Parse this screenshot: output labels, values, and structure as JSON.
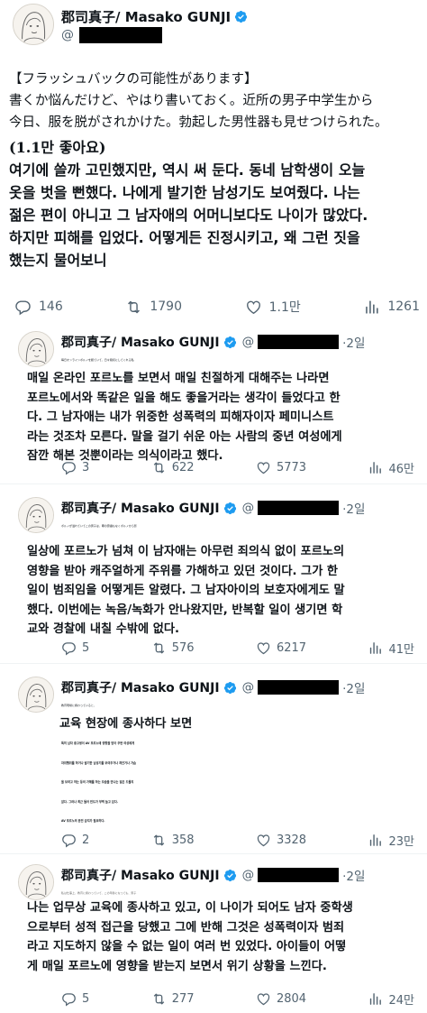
{
  "main": {
    "name": "郡司真子/ Masako GUNJI",
    "handle": "@",
    "jp_lines": [
      "【フラッシュバックの可能性があります】",
      "書くか悩んだけど、やはり書いておく。近所の男子中学生から",
      "今日、服を脱がされかけた。勃起した男性器も見せつけられた。"
    ],
    "likes_note": "(1.1만 좋아요)",
    "kr_lines": [
      "여기에 쓸까 고민했지만, 역시 써 둔다. 동네 남학생이 오늘",
      "옷을 벗을 뻔했다. 나에게 발기한 남성기도 보여줬다. 나는",
      "젊은 편이 아니고 그 남자애의 어머니보다도 나이가 많았다.",
      "하지만 피해를 입었다. 어떻게든 진정시키고, 왜 그런 짓을",
      "했는지 물어보니"
    ],
    "actions": {
      "replies": "146",
      "retweets": "1790",
      "likes": "1.1만",
      "views": "1261"
    }
  },
  "replies": [
    {
      "name": "郡司真子/ Masako GUNJI",
      "handle": "@",
      "date": "·2일",
      "jp_lines": [
        "毎日オンラインポルノを観ていて、日々親切にしてくれる私"
      ],
      "kr_lines": [
        "매일 온라인 포르노를 보면서 매일 친절하게 대해주는 나라면",
        "포르노에서와 똑같은 일을 해도 좋을거라는 생각이 들었다고 한",
        "다. 그 남자애는 내가 위중한 성폭력의 피해자이자 페미니스트",
        "라는 것조차 모른다. 말을 걸기 쉬운 아는 사람의 중년 여성에게",
        "잠깐 해본 것뿐이라는 의식이라고 했다."
      ],
      "actions": {
        "replies": "3",
        "retweets": "622",
        "likes": "5773",
        "views": "46만"
      }
    },
    {
      "name": "郡司真子/ Masako GUNJI",
      "handle": "@",
      "date": "·2일",
      "jp_lines": [
        "ポルノが溢れていてこの男子は、罪の意識もなくポルノから影"
      ],
      "kr_lines": [
        "일상에 포르노가 넘쳐 이 남자애는 아무런 죄의식 없이 포르노의",
        "영향을 받아 캐주얼하게 주위를 가해하고 있던 것이다. 그가 한",
        "일이 범죄임을 어떻게든 알렸다. 그 남자아이의 보호자에게도 말",
        "했다. 이번에는 녹음/녹화가 안나왔지만, 반복할 일이 생기면 학",
        "교와 경찰에 내칠 수밖에 없다."
      ],
      "actions": {
        "replies": "5",
        "retweets": "576",
        "likes": "6217",
        "views": "41만"
      }
    },
    {
      "name": "郡司真子/ Masako GUNJI",
      "handle": "@",
      "date": "·2일",
      "jp_lines": [
        "教育現場に携わっていると、"
      ],
      "kr_lines": [
        "교육 현장에 종사하다 보면",
        "특히 남자 중고생이 AV 포르노에 영향을 받아 주변 여성에게",
        "자위행위를 하거나 발기한 남성기를 보여주거나 껴안거나 가슴",
        "을 보려고 하는 등의 가해를 하는 모습을 만나는 일은 드물지",
        "않다. 그러나 최근 들어 빈도가 부쩍 늘고 있다.",
        "AV 포르노의 완전 금지가 필요하다."
      ],
      "actions": {
        "replies": "2",
        "retweets": "358",
        "likes": "3328",
        "views": "23만"
      }
    },
    {
      "name": "郡司真子/ Masako GUNJI",
      "handle": "@",
      "date": "·2일",
      "jp_lines": [
        "私は仕事上、教育に携わっていて、この年齢になっても、男子"
      ],
      "kr_lines": [
        "나는 업무상 교육에 종사하고 있고, 이 나이가 되어도 남자 중학생",
        "으로부터 성적 접근을 당했고 그에 반해 그것은 성폭력이자 범죄",
        "라고 지도하지 않을 수 없는 일이 여러 번 있었다. 아이들이 어떻",
        "게 매일 포르노에 영향을 받는지 보면서 위기 상황을 느낀다."
      ],
      "actions": {
        "replies": "5",
        "retweets": "277",
        "likes": "2804",
        "views": "24만"
      }
    }
  ],
  "colors": {
    "verified": "#1d9bf0",
    "muted": "#536471",
    "text": "#0f1419"
  },
  "icons": [
    "verified-badge-icon",
    "reply-icon",
    "retweet-icon",
    "like-icon",
    "views-icon"
  ]
}
